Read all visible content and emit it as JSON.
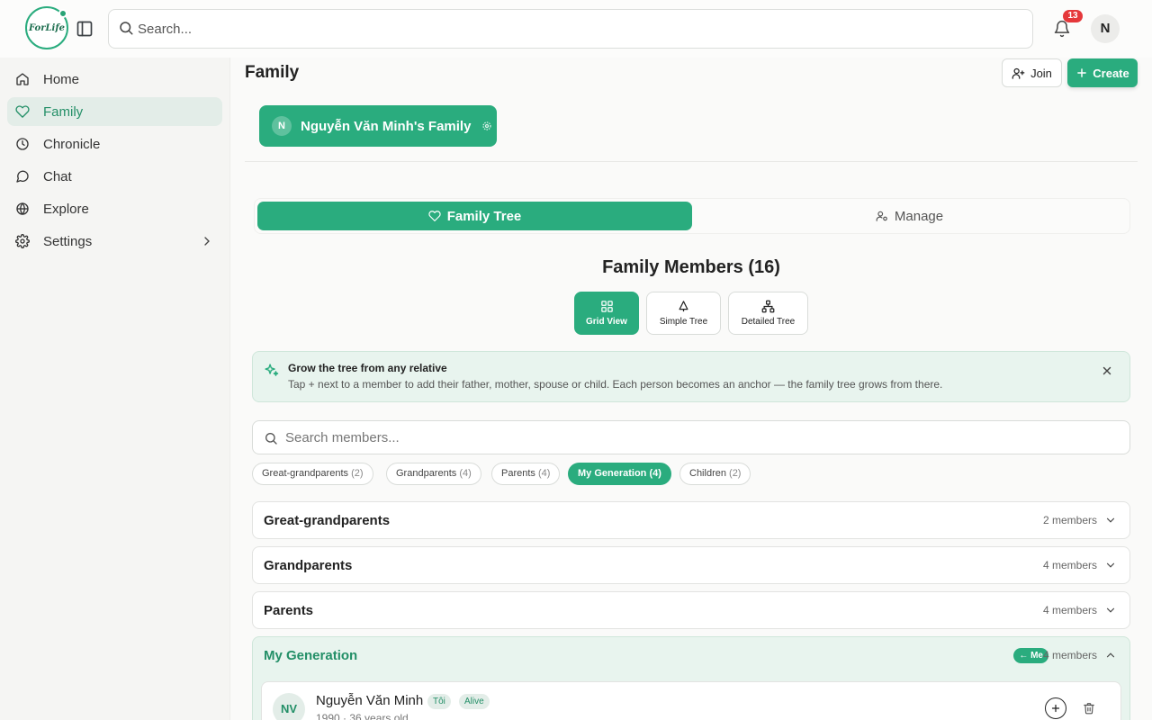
{
  "header": {
    "logo_text": "ForLife",
    "search_placeholder": "Search...",
    "notification_count": "13",
    "avatar_initial": "N"
  },
  "sidebar": {
    "items": [
      {
        "label": "Home",
        "icon": "home-icon"
      },
      {
        "label": "Family",
        "icon": "heart-icon",
        "active": true
      },
      {
        "label": "Chronicle",
        "icon": "clock-icon"
      },
      {
        "label": "Chat",
        "icon": "chat-icon"
      },
      {
        "label": "Explore",
        "icon": "globe-icon"
      },
      {
        "label": "Settings",
        "icon": "gear-icon",
        "has_submenu": true
      }
    ]
  },
  "main": {
    "page_title": "Family",
    "join_label": "Join",
    "create_label": "Create",
    "family": {
      "avatar_initial": "N",
      "name": "Nguyễn Văn Minh's Family"
    },
    "tabs": [
      {
        "label": "Family Tree",
        "active": true
      },
      {
        "label": "Manage",
        "active": false
      }
    ],
    "members_title": "Family Members (16)",
    "views": [
      {
        "label": "Grid View",
        "active": true
      },
      {
        "label": "Simple Tree",
        "active": false
      },
      {
        "label": "Detailed Tree",
        "active": false
      }
    ],
    "tip": {
      "title": "Grow the tree from any relative",
      "text": "Tap + next to a member to add their father, mother, spouse or child. Each person becomes an anchor — the family tree grows from there."
    },
    "member_search_placeholder": "Search members...",
    "filters": [
      {
        "label": "Great-grandparents",
        "count": "(2)"
      },
      {
        "label": "Grandparents",
        "count": "(4)"
      },
      {
        "label": "Parents",
        "count": "(4)"
      },
      {
        "label": "My Generation",
        "count": "(4)",
        "active": true
      },
      {
        "label": "Children",
        "count": "(2)"
      }
    ],
    "generations": [
      {
        "label": "Great-grandparents",
        "count": "2 members"
      },
      {
        "label": "Grandparents",
        "count": "4 members"
      },
      {
        "label": "Parents",
        "count": "4 members"
      },
      {
        "label": "My Generation",
        "count": "4 members",
        "badge": "← Me",
        "open": true
      }
    ],
    "member": {
      "initials": "NV",
      "name": "Nguyễn Văn Minh",
      "tag_self": "Tôi",
      "tag_status": "Alive",
      "subtitle": "1990 · 36 years old"
    }
  },
  "colors": {
    "accent": "#2aac7e",
    "accent_light": "#e8f4ee",
    "badge": "#e5383b"
  }
}
